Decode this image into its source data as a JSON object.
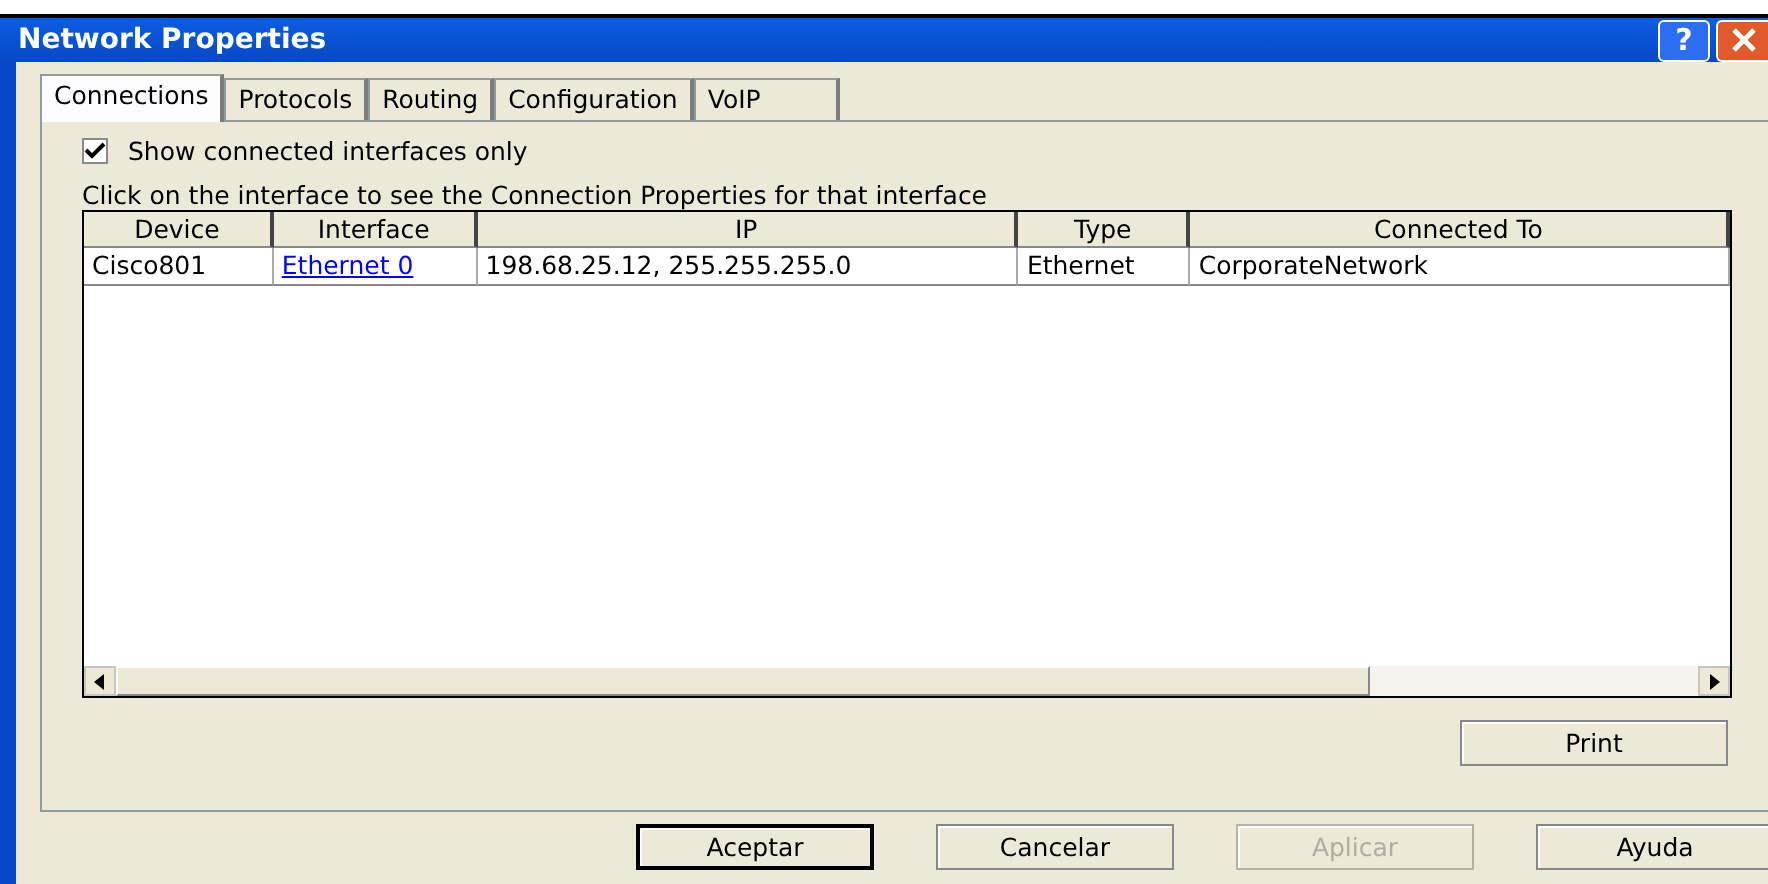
{
  "window": {
    "title": "Network Properties"
  },
  "title_buttons": [
    {
      "kind": "help",
      "label": "?"
    },
    {
      "kind": "close"
    }
  ],
  "tabs": [
    {
      "label": "Connections",
      "selected": true
    },
    {
      "label": "Protocols",
      "selected": false
    },
    {
      "label": "Routing",
      "selected": false
    },
    {
      "label": "Configuration",
      "selected": false
    },
    {
      "label": "VoIP",
      "selected": false
    }
  ],
  "show_connected_only": {
    "label": "Show connected interfaces only",
    "checked": true
  },
  "instruction": "Click on the interface to see the Connection Properties for that interface",
  "table": {
    "columns": [
      "Device",
      "Interface",
      "IP",
      "Type",
      "Connected To"
    ],
    "rows": [
      {
        "cells": [
          {
            "text": "Cisco801",
            "kind": "text"
          },
          {
            "text": "Ethernet 0",
            "kind": "link"
          },
          {
            "text": "198.68.25.12, 255.255.255.0",
            "kind": "text"
          },
          {
            "text": "Ethernet",
            "kind": "text"
          },
          {
            "text": "CorporateNetwork",
            "kind": "text"
          }
        ]
      }
    ]
  },
  "print_button": "Print",
  "buttons": [
    {
      "label": "Aceptar",
      "disabled": false,
      "default": true
    },
    {
      "label": "Cancelar",
      "disabled": false,
      "default": false
    },
    {
      "label": "Aplicar",
      "disabled": true,
      "default": false
    },
    {
      "label": "Ayuda",
      "disabled": false,
      "default": false
    }
  ]
}
